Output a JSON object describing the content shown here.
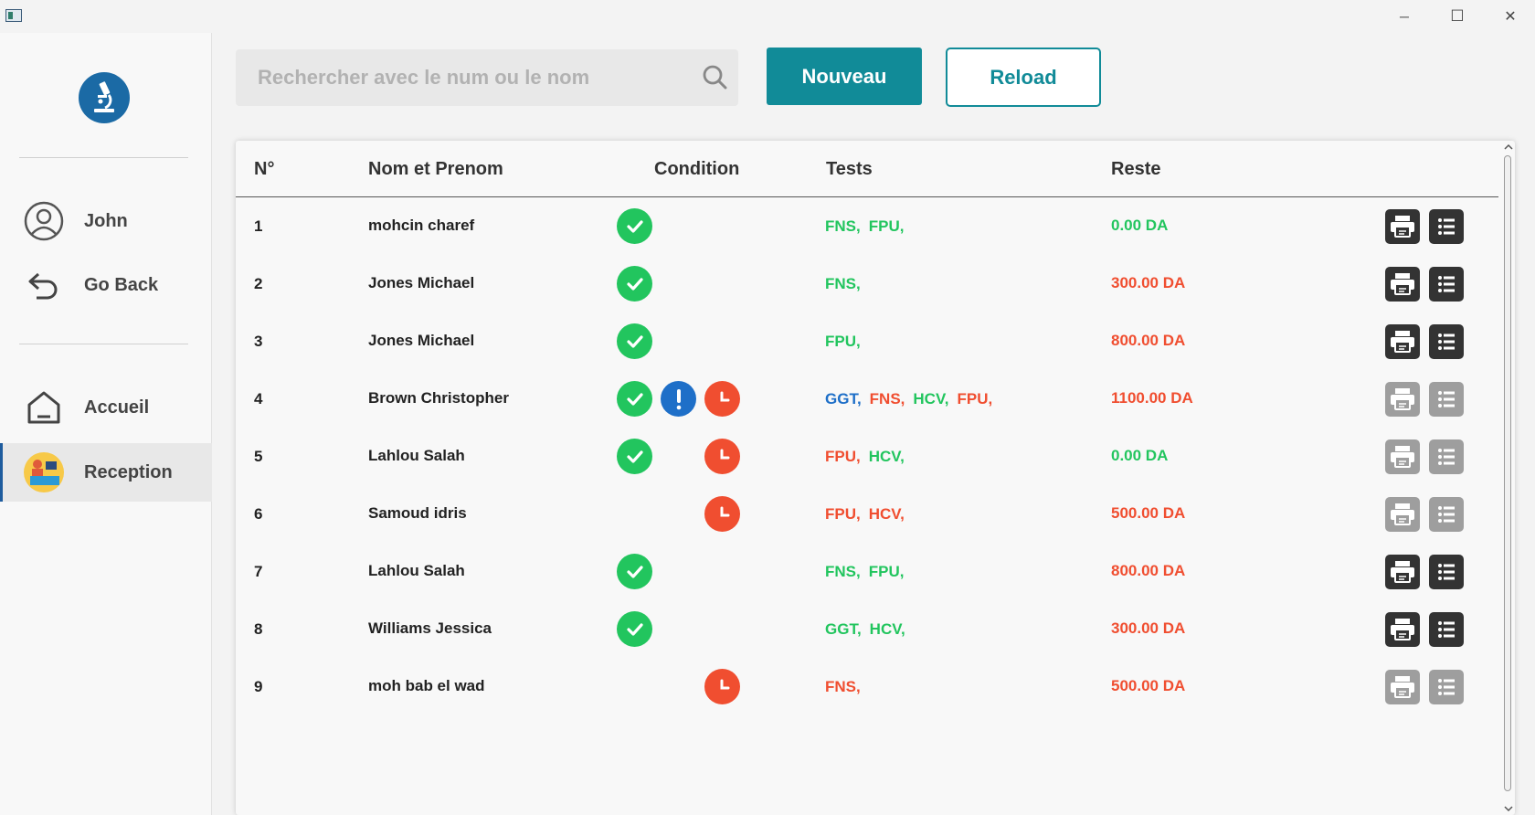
{
  "window": {
    "minimize_glyph": "─",
    "maximize_glyph": "☐",
    "close_glyph": "✕"
  },
  "sidebar": {
    "user_label": "John",
    "goback_label": "Go Back",
    "accueil_label": "Accueil",
    "reception_label": "Reception"
  },
  "toolbar": {
    "search_placeholder": "Rechercher avec le num ou le nom",
    "new_label": "Nouveau",
    "reload_label": "Reload"
  },
  "table": {
    "headers": {
      "num": "N°",
      "name": "Nom et Prenom",
      "condition": "Condition",
      "tests": "Tests",
      "reste": "Reste"
    },
    "rows": [
      {
        "num": "1",
        "name": "mohcin charef",
        "reste": "0.00 DA",
        "tests": [
          "FNS,",
          "FPU,"
        ]
      },
      {
        "num": "2",
        "name": "Jones Michael",
        "reste": "300.00 DA",
        "tests": [
          "FNS,"
        ]
      },
      {
        "num": "3",
        "name": "Jones Michael",
        "reste": "800.00 DA",
        "tests": [
          "FPU,"
        ]
      },
      {
        "num": "4",
        "name": "Brown Christopher",
        "reste": "1100.00 DA",
        "tests": [
          "GGT,",
          "FNS,",
          "HCV,",
          "FPU,"
        ]
      },
      {
        "num": "5",
        "name": "Lahlou Salah",
        "reste": "0.00 DA",
        "tests": [
          "FPU,",
          "HCV,"
        ]
      },
      {
        "num": "6",
        "name": "Samoud idris",
        "reste": "500.00 DA",
        "tests": [
          "FPU,",
          "HCV,"
        ]
      },
      {
        "num": "7",
        "name": "Lahlou Salah",
        "reste": "800.00 DA",
        "tests": [
          "FNS,",
          "FPU,"
        ]
      },
      {
        "num": "8",
        "name": "Williams Jessica",
        "reste": "300.00 DA",
        "tests": [
          "GGT,",
          "HCV,"
        ]
      },
      {
        "num": "9",
        "name": "moh bab el wad",
        "reste": "500.00 DA",
        "tests": [
          "FNS,"
        ]
      }
    ]
  },
  "colors": {
    "accent": "#118b98",
    "green": "#22c55e",
    "red": "#f04e30",
    "blue": "#1e6fc8",
    "dark": "#333333",
    "disabled": "#9e9e9e"
  }
}
